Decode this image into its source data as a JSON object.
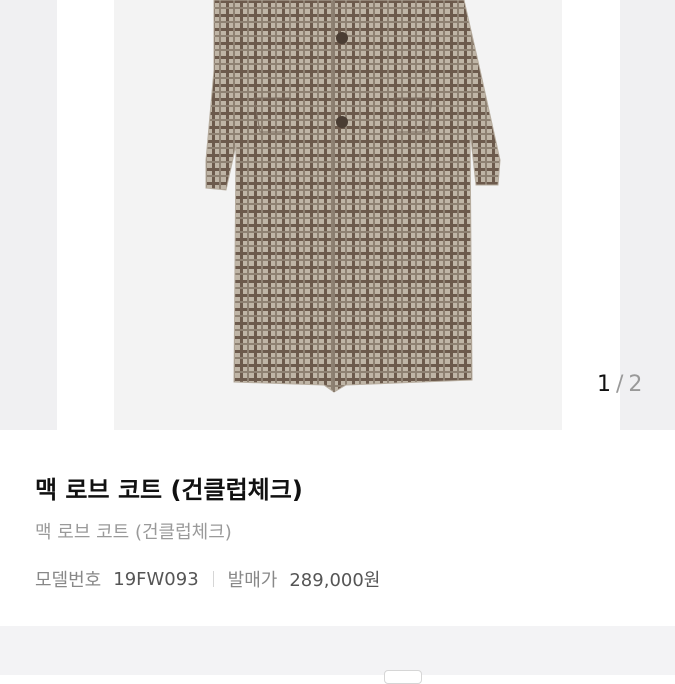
{
  "gallery": {
    "current": "1",
    "separator": "/",
    "total": "2",
    "image": "checked long wool coat photo",
    "colors": {
      "side_panel": "#f0f0f2",
      "photo_bg": "#f3f3f3"
    }
  },
  "product": {
    "title": "맥 로브 코트 (건클럽체크)",
    "subtitle": "맥 로브 코트 (건클럽체크)",
    "model_label": "모델번호",
    "model_value": "19FW093",
    "price_label": "발매가",
    "price_value": "289,000원"
  }
}
